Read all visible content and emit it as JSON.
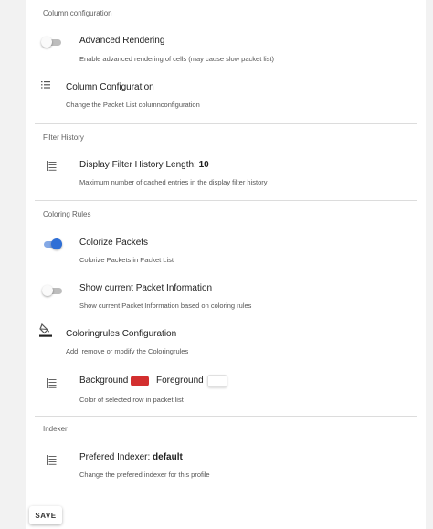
{
  "sections": {
    "column_configuration": {
      "header": "Column configuration",
      "advanced_rendering": {
        "title": "Advanced Rendering",
        "description": "Enable advanced rendering of cells (may cause slow packet list)",
        "enabled": false,
        "icon": "toggle-switch"
      },
      "column_config": {
        "title": "Column Configuration",
        "description": "Change the Packet List columnconfiguration",
        "icon": "list-icon"
      }
    },
    "filter_history": {
      "header": "Filter History",
      "length": {
        "label": "Display Filter History Length: ",
        "value": "10",
        "description": "Maximum number of cached entries in the display filter history",
        "icon": "settings-list-icon"
      }
    },
    "coloring_rules": {
      "header": "Coloring Rules",
      "colorize": {
        "title": "Colorize Packets",
        "description": "Colorize Packets in Packet List",
        "enabled": true
      },
      "show_info": {
        "title": "Show current Packet Information",
        "description": "Show current Packet Information based on coloring rules",
        "enabled": false
      },
      "rules_config": {
        "title": "Coloringrules Configuration",
        "description": "Add, remove or modify the Coloringrules",
        "icon": "paint-bucket-icon"
      },
      "selected_row": {
        "background_label": "Background",
        "foreground_label": "Foreground",
        "background_color": "#d32f2f",
        "foreground_color": "#ffffff",
        "description": "Color of selected row in packet list"
      }
    },
    "indexer": {
      "header": "Indexer",
      "prefered": {
        "label": "Prefered Indexer: ",
        "value": "default",
        "description": "Change the prefered indexer for this profile"
      }
    }
  },
  "actions": {
    "save_label": "SAVE"
  },
  "colors": {
    "accent": "#2f6fd6",
    "accent_track": "#84a9e6",
    "divider": "#dcdcdc"
  }
}
